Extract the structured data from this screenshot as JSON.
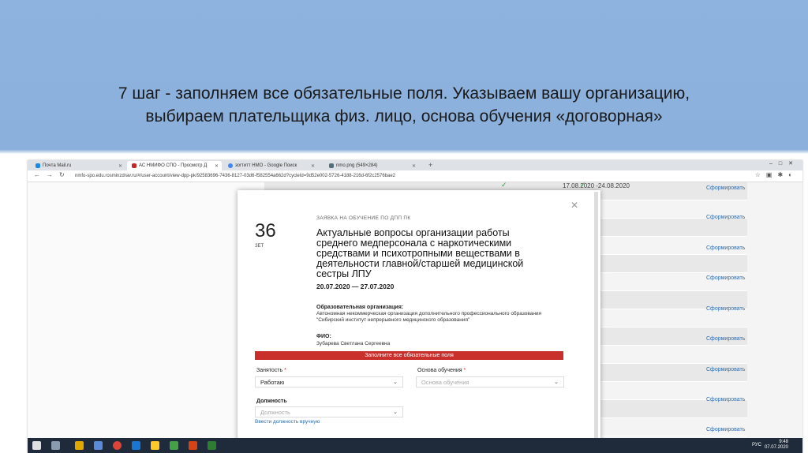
{
  "slide": {
    "title_line1": "7 шаг - заполняем все обязательные поля. Указываем вашу организацию,",
    "title_line2": "выбираем плательщика физ. лицо, основа обучения «договорная»"
  },
  "browser": {
    "tabs": [
      {
        "label": "Почта Mail.ru",
        "icon": "mail-icon",
        "color": "#1e88e5"
      },
      {
        "label": "АС НМИФО СПО - Просмотр Д",
        "icon": "site-icon",
        "color": "#c62828"
      },
      {
        "label": "зоrтитт НМО - Google Поиск",
        "icon": "google-icon",
        "color": "#4285f4"
      },
      {
        "label": "nmo.png (549×284)",
        "icon": "image-icon",
        "color": "#546e7a"
      }
    ],
    "url": "nmfo-spo.edu.rosminzdrav.ru/#/user-account/view-dpp-pk/92583696-7436-8127-03d6-f582554a662d?cycleId=9d52e002-5726-4188-216d-6f2c2576bae2"
  },
  "background_table": {
    "first_date": "17.08.2020 -24.08.2020",
    "action_label": "Сформировать"
  },
  "modal": {
    "kind": "ЗАЯВКА НА ОБУЧЕНИЕ ПО ДПП ПК",
    "hours": "36",
    "hours_unit": "ЗЕТ",
    "course_title": "Актуальные вопросы организации работы среднего медперсонала с наркотическими средствами и психотропными веществами в деятельности главной/старшей медицинской сестры ЛПУ",
    "dates": "20.07.2020 — 27.07.2020",
    "org_label": "Образовательная организация:",
    "org_value": "Автономная некоммерческая организация дополнительного профессионального образования \"Сибирский институт непрерывного медицинского образования\"",
    "fio_label": "ФИО:",
    "fio_value": "Зубарева Светлана Сергеевна",
    "error": "Заполните все обязательные поля",
    "employment_label": "Занятость",
    "employment_value": "Работаю",
    "basis_label": "Основа обучения",
    "basis_placeholder": "Основа обучения",
    "position_label": "Должность",
    "position_placeholder": "Должность",
    "manual_link": "Ввести должность вручную",
    "required_mark": "*"
  },
  "taskbar": {
    "lang": "РУС",
    "time": "9:48",
    "date": "07.07.2020"
  },
  "colors": {
    "error": "#c9302c",
    "link": "#2b6cb0",
    "slide_bg": "#8fb3df"
  }
}
